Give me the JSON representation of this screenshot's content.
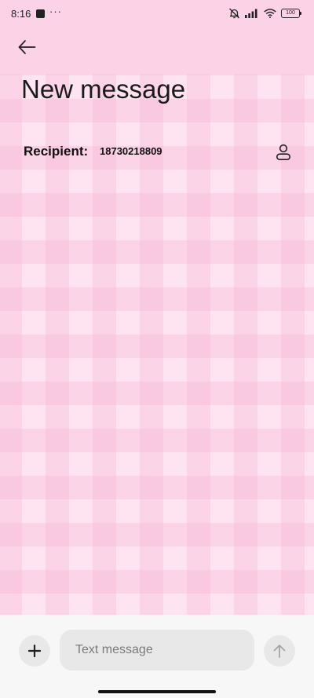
{
  "status_bar": {
    "time": "8:16",
    "dots": "···",
    "battery": "100",
    "icons": [
      "notification-square-icon",
      "mute-bell-icon",
      "signal-icon",
      "wifi-icon",
      "battery-icon"
    ]
  },
  "header": {
    "back_icon": "arrow-left-icon",
    "title": "New message"
  },
  "recipient": {
    "label": "Recipient:",
    "value": "18730218809",
    "contact_icon": "person-icon"
  },
  "compose": {
    "add_icon": "plus-icon",
    "placeholder": "Text message",
    "value": "",
    "send_icon": "arrow-up-icon"
  },
  "colors": {
    "header_background": "#fbd2e6",
    "check_light": "#fde4f0",
    "check_dark": "#f6c3dc",
    "compose_background": "#f7f7f7",
    "button_background": "#e8e8e8"
  }
}
